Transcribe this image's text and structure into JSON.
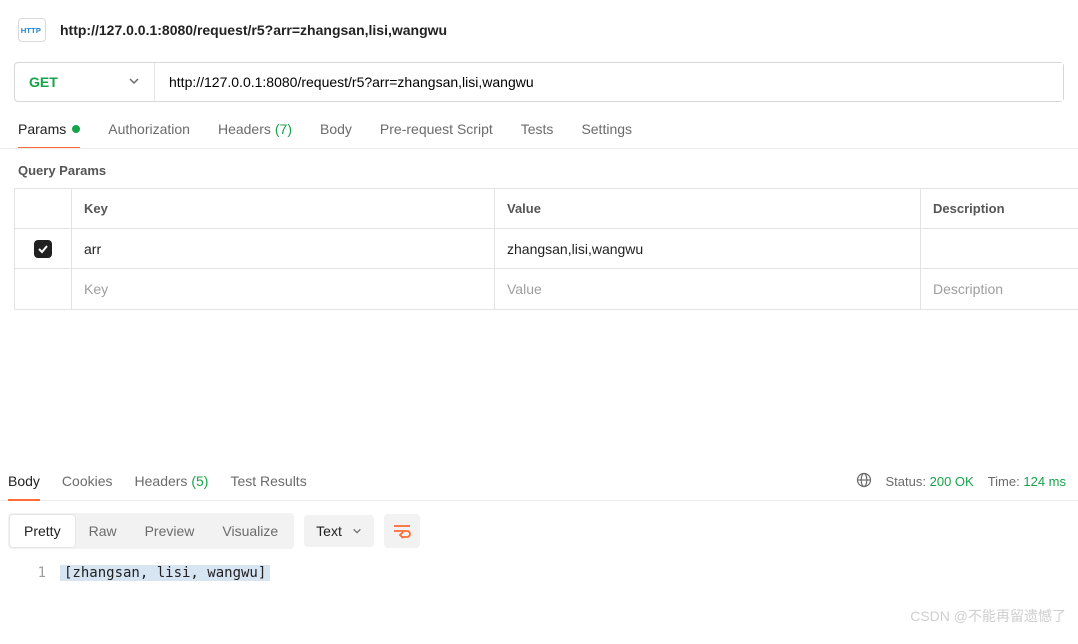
{
  "header": {
    "icon_label": "HTTP",
    "url_display": "http://127.0.0.1:8080/request/r5?arr=zhangsan,lisi,wangwu"
  },
  "request": {
    "method": "GET",
    "url": "http://127.0.0.1:8080/request/r5?arr=zhangsan,lisi,wangwu"
  },
  "tabs": {
    "params": "Params",
    "authorization": "Authorization",
    "headers": "Headers",
    "headers_count": "(7)",
    "body": "Body",
    "prerequest": "Pre-request Script",
    "tests": "Tests",
    "settings": "Settings"
  },
  "query": {
    "title": "Query Params",
    "th_key": "Key",
    "th_value": "Value",
    "th_desc": "Description",
    "rows": [
      {
        "checked": true,
        "key": "arr",
        "value": "zhangsan,lisi,wangwu",
        "desc": ""
      }
    ],
    "placeholder_key": "Key",
    "placeholder_value": "Value",
    "placeholder_desc": "Description"
  },
  "response": {
    "tabs": {
      "body": "Body",
      "cookies": "Cookies",
      "headers": "Headers",
      "headers_count": "(5)",
      "test_results": "Test Results"
    },
    "status_label": "Status:",
    "status_value": "200 OK",
    "time_label": "Time:",
    "time_value": "124 ms",
    "views": {
      "pretty": "Pretty",
      "raw": "Raw",
      "preview": "Preview",
      "visualize": "Visualize"
    },
    "format": "Text",
    "line_no": "1",
    "body_text": "[zhangsan, lisi, wangwu]"
  },
  "watermark": "CSDN @不能再留遗憾了"
}
